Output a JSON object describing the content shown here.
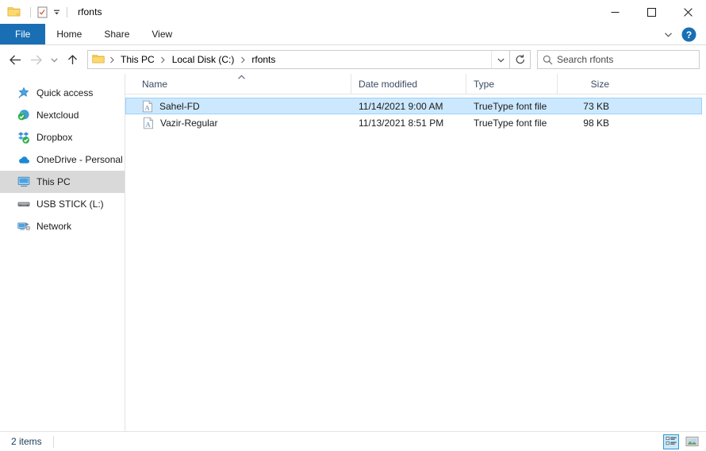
{
  "window": {
    "title": "rfonts",
    "quick_access_toolbar": [
      {
        "name": "folder-icon",
        "label": "rfonts folder"
      },
      {
        "name": "properties-icon",
        "label": "Properties"
      },
      {
        "name": "customize-caret-icon",
        "label": "Customize Quick Access Toolbar"
      }
    ],
    "controls": {
      "minimize": "─",
      "maximize": "☐",
      "close": "✕"
    }
  },
  "ribbon": {
    "tabs": [
      {
        "label": "File",
        "active": true
      },
      {
        "label": "Home",
        "active": false
      },
      {
        "label": "Share",
        "active": false
      },
      {
        "label": "View",
        "active": false
      }
    ],
    "expand_label": "Expand the Ribbon",
    "help_label": "?"
  },
  "address": {
    "back_label": "Back",
    "forward_label": "Forward",
    "recent_label": "Recent locations",
    "up_label": "Up",
    "breadcrumbs": [
      {
        "label": "This PC"
      },
      {
        "label": "Local Disk (C:)"
      },
      {
        "label": "rfonts"
      }
    ],
    "separator": "›",
    "refresh_label": "Refresh",
    "dropdown_label": "Previous locations"
  },
  "search": {
    "placeholder": "Search rfonts",
    "value": ""
  },
  "sidebar": {
    "items": [
      {
        "label": "Quick access",
        "icon": "star-icon",
        "selected": false
      },
      {
        "label": "Nextcloud",
        "icon": "nextcloud-icon",
        "selected": false
      },
      {
        "label": "Dropbox",
        "icon": "dropbox-icon",
        "selected": false
      },
      {
        "label": "OneDrive - Personal",
        "icon": "cloud-icon",
        "selected": false
      },
      {
        "label": "This PC",
        "icon": "monitor-icon",
        "selected": true
      },
      {
        "label": "USB STICK (L:)",
        "icon": "usb-drive-icon",
        "selected": false
      },
      {
        "label": "Network",
        "icon": "network-icon",
        "selected": false
      }
    ]
  },
  "filelist": {
    "columns": [
      {
        "label": "Name",
        "sorted": "asc"
      },
      {
        "label": "Date modified",
        "sorted": ""
      },
      {
        "label": "Type",
        "sorted": ""
      },
      {
        "label": "Size",
        "sorted": ""
      }
    ],
    "rows": [
      {
        "name": "Sahel-FD",
        "date_modified": "11/14/2021 9:00 AM",
        "type": "TrueType font file",
        "size": "73 KB",
        "icon": "font-file-icon",
        "selected": true
      },
      {
        "name": "Vazir-Regular",
        "date_modified": "11/13/2021 8:51 PM",
        "type": "TrueType font file",
        "size": "98 KB",
        "icon": "font-file-icon",
        "selected": false
      }
    ]
  },
  "statusbar": {
    "item_count": "2 items",
    "views": [
      {
        "name": "details-view",
        "label": "Details view",
        "active": true
      },
      {
        "name": "large-icons-view",
        "label": "Large icons view",
        "active": false
      }
    ]
  },
  "colors": {
    "accent": "#1a6fb4",
    "selection_fill": "#cce8ff",
    "selection_border": "#99d1ff",
    "sidebar_selected": "#d9d9d9",
    "header_text": "#3a4a63",
    "folder_yellow": "#ffd04d"
  }
}
